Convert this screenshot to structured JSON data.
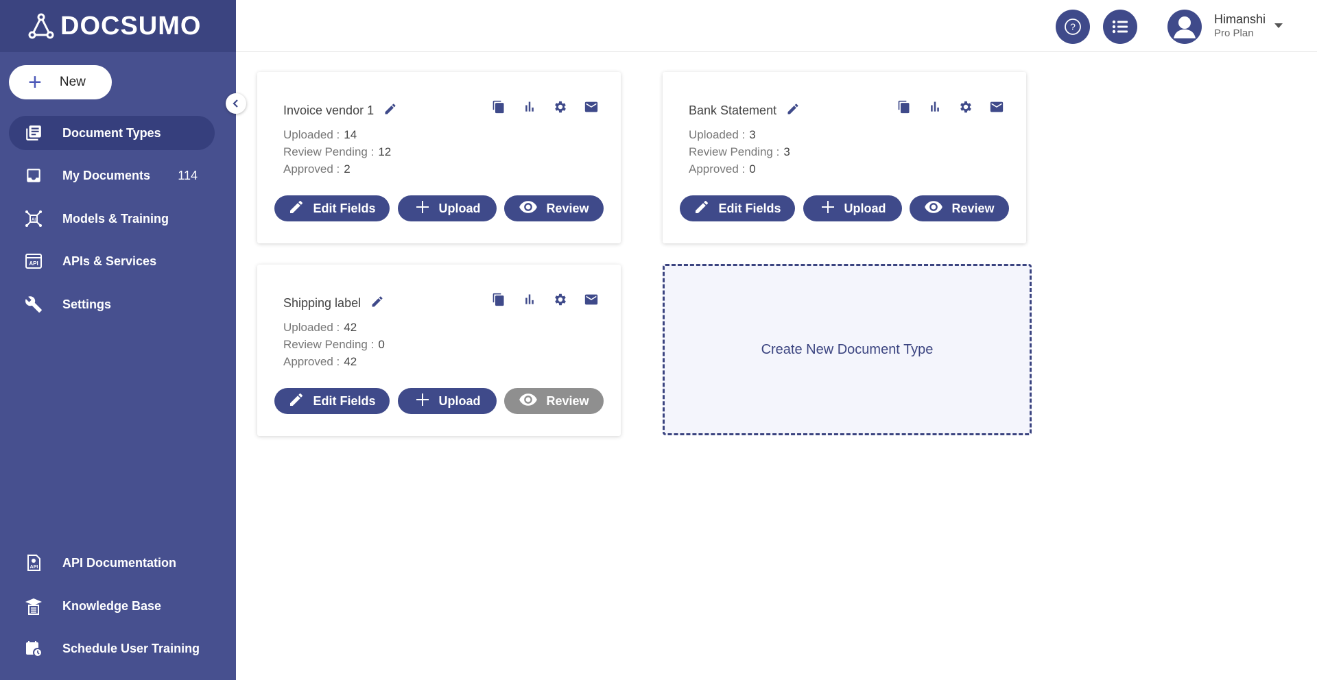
{
  "app": {
    "logo_text": "DOCSUMO"
  },
  "sidebar": {
    "new_label": "New",
    "items": [
      {
        "label": "Document Types",
        "icon": "document-types-icon",
        "active": true
      },
      {
        "label": "My Documents",
        "icon": "inbox-icon",
        "count": "114"
      },
      {
        "label": "Models & Training",
        "icon": "ai-model-icon"
      },
      {
        "label": "APIs & Services",
        "icon": "api-icon"
      },
      {
        "label": "Settings",
        "icon": "tools-icon"
      }
    ],
    "bottom_items": [
      {
        "label": "API Documentation",
        "icon": "api-doc-icon"
      },
      {
        "label": "Knowledge Base",
        "icon": "graduation-cap-icon"
      },
      {
        "label": "Schedule User Training",
        "icon": "calendar-clock-icon"
      }
    ]
  },
  "header": {
    "user_name": "Himanshi",
    "user_plan": "Pro Plan"
  },
  "labels": {
    "uploaded": "Uploaded :",
    "review_pending": "Review Pending :",
    "approved": "Approved :",
    "edit_fields": "Edit Fields",
    "upload": "Upload",
    "review": "Review"
  },
  "cards": [
    {
      "title": "Invoice vendor 1",
      "uploaded": "14",
      "review_pending": "12",
      "approved": "2",
      "review_enabled": true
    },
    {
      "title": "Bank Statement",
      "uploaded": "3",
      "review_pending": "3",
      "approved": "0",
      "review_enabled": true
    },
    {
      "title": "Shipping label",
      "uploaded": "42",
      "review_pending": "0",
      "approved": "42",
      "review_enabled": false
    }
  ],
  "create_card": {
    "label": "Create New Document Type"
  },
  "colors": {
    "sidebar": "#47508f",
    "logo_bar": "#3b4480",
    "accent": "#3f4a8a",
    "disabled": "#8f8f8f"
  }
}
